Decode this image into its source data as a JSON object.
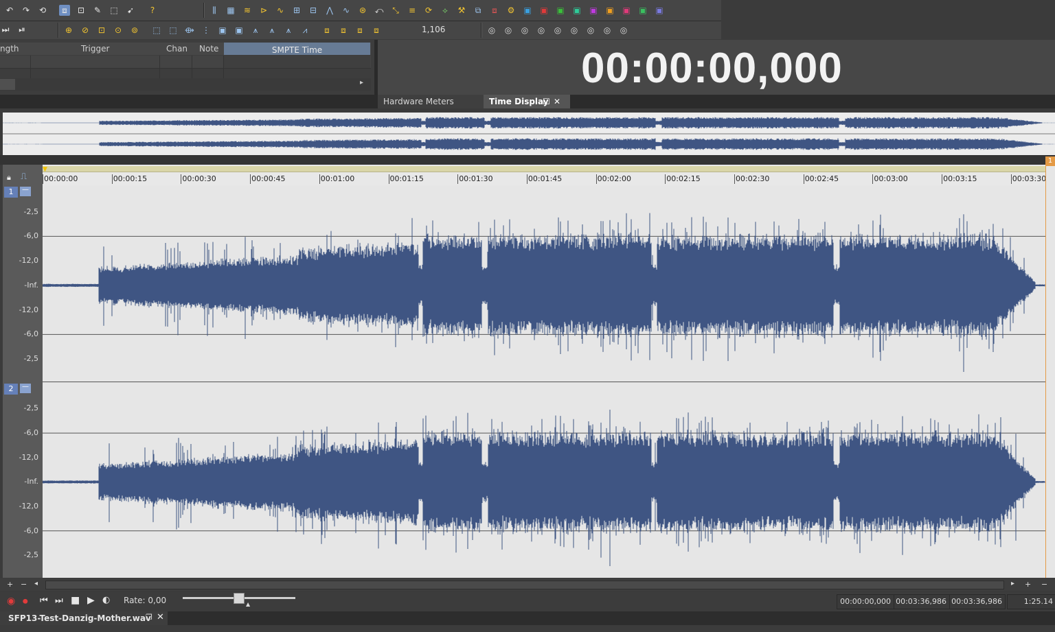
{
  "toolbar": {
    "counter_value": "1,106"
  },
  "midi_table": {
    "headers": [
      "ngth",
      "Trigger",
      "Chan",
      "Note",
      "SMPTE Time"
    ]
  },
  "time_display": {
    "value": "00:00:00,000"
  },
  "panel_tabs": [
    "Hardware Meters",
    "Time Display"
  ],
  "ruler": {
    "labels": [
      "00:00:00",
      "00:00:15",
      "00:00:30",
      "00:00:45",
      "00:01:00",
      "00:01:15",
      "00:01:30",
      "00:01:45",
      "00:02:00",
      "00:02:15",
      "00:02:30",
      "00:02:45",
      "00:03:00",
      "00:03:15",
      "00:03:30"
    ],
    "marker": "1"
  },
  "channels": [
    {
      "num": "1",
      "db_labels": [
        "-2,5",
        "-6,0",
        "-12,0",
        "-Inf.",
        "-12,0",
        "-6,0",
        "-2,5"
      ]
    },
    {
      "num": "2",
      "db_labels": [
        "-2,5",
        "-6,0",
        "-12,0",
        "-Inf.",
        "-12,0",
        "-6,0",
        "-2,5"
      ]
    }
  ],
  "transport": {
    "rate_label": "Rate: 0,00",
    "start": "00:00:00,000",
    "end": "00:03:36,986",
    "length": "00:03:36,986",
    "zoom": "1:25.14"
  },
  "doc_tab": {
    "filename": "SFP13-Test-Danzig-Mother.wav"
  },
  "colors": {
    "waveform": "#3f5583",
    "wave_bg": "#e6e6e6",
    "ruler_bg": "#e8e8e8"
  }
}
